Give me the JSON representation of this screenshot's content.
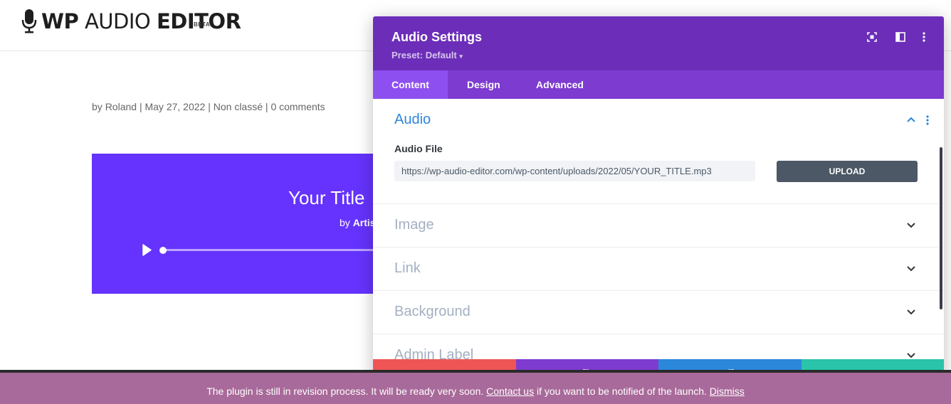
{
  "site": {
    "logo_wp": "WP",
    "logo_audio": "AUDIO",
    "logo_editor": "EDITOR",
    "logo_badge": "BETA"
  },
  "post_meta": {
    "by": "by",
    "author": "Roland",
    "sep1": "|",
    "date": "May 27, 2022",
    "sep2": "|",
    "category": "Non classé",
    "sep3": "|",
    "comments": "0 comments"
  },
  "player": {
    "title": "Your Title",
    "by": "by",
    "artist": "Artis",
    "background_color": "#6533fd",
    "progress": 0
  },
  "modal": {
    "title": "Audio Settings",
    "preset": "Preset: Default",
    "tabs": [
      {
        "label": "Content",
        "active": true
      },
      {
        "label": "Design",
        "active": false
      },
      {
        "label": "Advanced",
        "active": false
      }
    ],
    "audio_section": {
      "title": "Audio",
      "field_label": "Audio File",
      "url_value": "https://wp-audio-editor.com/wp-content/uploads/2022/05/YOUR_TITLE.mp3",
      "upload_label": "UPLOAD"
    },
    "sections": [
      {
        "label": "Image"
      },
      {
        "label": "Link"
      },
      {
        "label": "Background"
      },
      {
        "label": "Admin Label"
      }
    ],
    "colors": {
      "header": "#6c2eb9",
      "tabs": "#7d3bd0",
      "active_tab": "#8e4ff0",
      "cancel": "#ef5555",
      "undo": "#7e3bd0",
      "redo": "#2b87da",
      "save": "#29c4a9"
    }
  },
  "notice": {
    "text_before": "The plugin is still in revision process. It will be ready very soon.",
    "contact_link": "Contact us",
    "text_after": "if you want to be notified of the launch.",
    "dismiss_link": "Dismiss"
  }
}
